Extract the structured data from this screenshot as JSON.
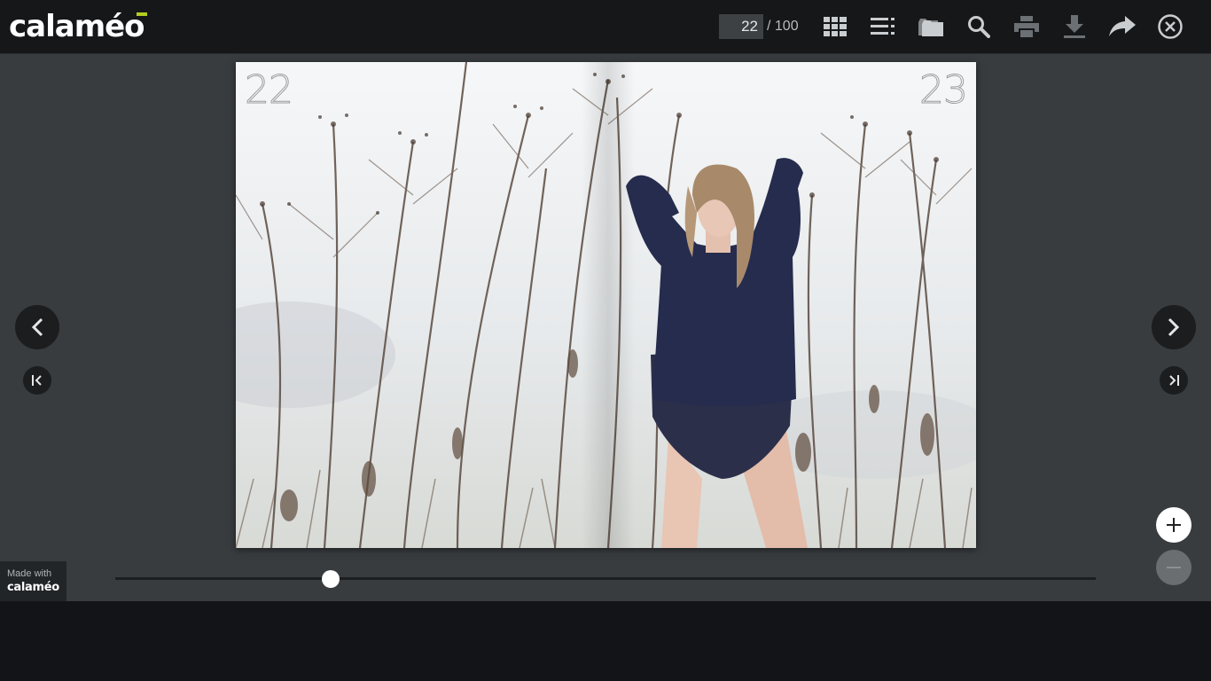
{
  "brand": {
    "logo_text": "calaméo",
    "accent": "#b4cc1e"
  },
  "toolbar": {
    "current_page": "22",
    "page_total": "/ 100",
    "icons": [
      "grid-icon",
      "menu-list-icon",
      "folder-icon",
      "search-icon",
      "print-icon",
      "download-icon",
      "share-icon",
      "close-icon"
    ]
  },
  "document": {
    "left_page_number": "22",
    "right_page_number": "23"
  },
  "navigation": {
    "prev": "chevron-left-icon",
    "next": "chevron-right-icon",
    "first": "first-page-icon",
    "last": "last-page-icon"
  },
  "zoom": {
    "in": "plus-icon",
    "out": "minus-icon"
  },
  "progress": {
    "fraction": 0.22
  },
  "footer_badge": {
    "line1": "Made with",
    "line2": "calaméo"
  },
  "colors": {
    "toolbar_bg": "#151719",
    "stage_bg": "#383c3f",
    "button_bg": "#1b1d1f",
    "icon_light": "#c9cdd0",
    "icon_dim": "#6b7074"
  }
}
